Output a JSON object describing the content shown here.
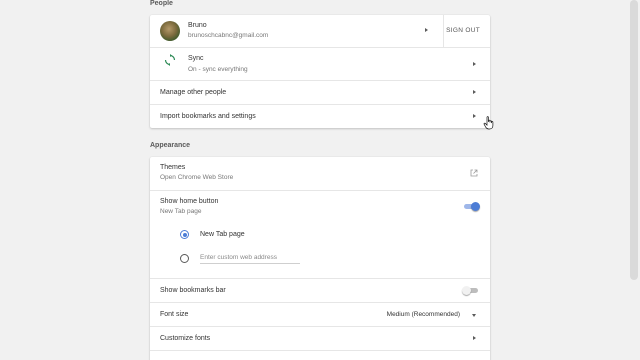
{
  "people": {
    "title": "People",
    "account": {
      "name": "Bruno",
      "email": "brunoschcabnc@gmail.com",
      "signout_label": "SIGN OUT"
    },
    "sync": {
      "label": "Sync",
      "status": "On - sync everything"
    },
    "manage_label": "Manage other people",
    "import_label": "Import bookmarks and settings"
  },
  "appearance": {
    "title": "Appearance",
    "themes": {
      "label": "Themes",
      "sub": "Open Chrome Web Store"
    },
    "home_button": {
      "label": "Show home button",
      "sub": "New Tab page",
      "enabled": true,
      "option_newtab": "New Tab page",
      "custom_placeholder": "Enter custom web address"
    },
    "bookmarks_bar": {
      "label": "Show bookmarks bar",
      "enabled": false
    },
    "font_size": {
      "label": "Font size",
      "value": "Medium (Recommended)"
    },
    "customize_fonts_label": "Customize fonts"
  },
  "colors": {
    "accent": "#4d7dd6",
    "toggle_on_track": "#9fb7e9",
    "toggle_off_track": "#bdbdbd",
    "toggle_off_knob": "#f1f1f1"
  }
}
